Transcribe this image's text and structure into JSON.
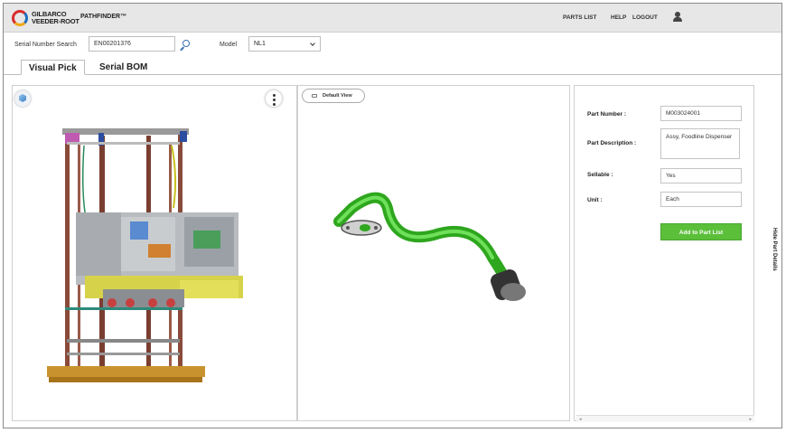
{
  "header": {
    "brand_line1": "GILBARCO",
    "brand_line2": "VEEDER-ROOT",
    "app_title": "PATHFINDER™",
    "nav": [
      "PARTS LIST",
      "HELP",
      "LOGOUT"
    ],
    "user_icon": "user-icon"
  },
  "search": {
    "serial_label": "Serial Number Search",
    "serial_value": "EN00201376",
    "model_label": "Model",
    "model_value": "NL1"
  },
  "tabs": [
    {
      "label": "Visual Pick",
      "active": true
    },
    {
      "label": "Serial BOM",
      "active": false
    }
  ],
  "viewer": {
    "default_view_label": "Default View"
  },
  "details": {
    "part_number_label": "Part Number :",
    "part_number_value": "M003024001",
    "part_description_label": "Part Description :",
    "part_description_value": "Assy, Foodline Dispenser",
    "sellable_label": "Sellable :",
    "sellable_value": "Yes",
    "unit_label": "Unit :",
    "unit_value": "Each",
    "add_button_label": "Add to Part List",
    "hide_details_label": "Hide Part Details"
  },
  "colors": {
    "accent_green": "#5bbf3a",
    "header_bg": "#e7e7e7"
  }
}
